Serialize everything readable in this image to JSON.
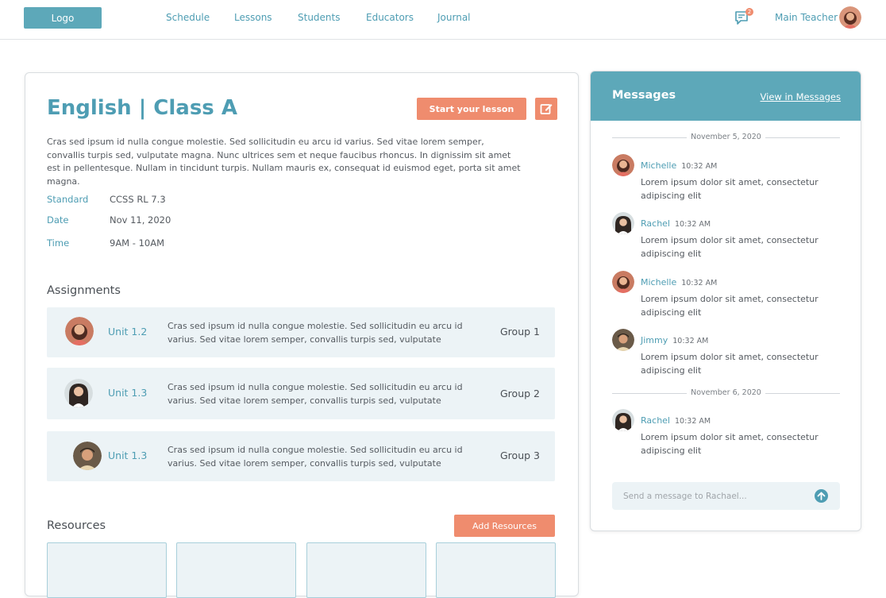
{
  "header": {
    "logo": "Logo",
    "nav": [
      "Schedule",
      "Lessons",
      "Students",
      "Educators",
      "Journal"
    ],
    "notification_count": "2",
    "user_name": "Main Teacher"
  },
  "lesson": {
    "title": "English | Class A",
    "start_button": "Start your lesson",
    "description": "Cras sed ipsum id nulla congue molestie. Sed sollicitudin eu arcu id varius. Sed vitae lorem semper, convallis turpis sed, vulputate magna. Nunc ultrices sem et neque faucibus rhoncus. In dignissim sit amet est in pellentesque. Nullam in tincidunt turpis. Nullam mauris ex, consequat id euismod eget, porta sit amet magna.",
    "meta": [
      {
        "label": "Standard",
        "value": "CCSS RL 7.3"
      },
      {
        "label": "Date",
        "value": "Nov 11, 2020"
      },
      {
        "label": "Time",
        "value": "9AM - 10AM"
      }
    ]
  },
  "assignments": {
    "heading": "Assignments",
    "items": [
      {
        "unit": "Unit 1.2",
        "text": "Cras sed ipsum id nulla congue molestie. Sed sollicitudin eu arcu id varius. Sed vitae lorem semper, convallis turpis sed, vulputate",
        "group": "Group 1"
      },
      {
        "unit": "Unit 1.3",
        "text": "Cras sed ipsum id nulla congue molestie. Sed sollicitudin eu arcu id varius. Sed vitae lorem semper, convallis turpis sed, vulputate",
        "group": "Group 2"
      },
      {
        "unit": "Unit 1.3",
        "text": "Cras sed ipsum id nulla congue molestie. Sed sollicitudin eu arcu id varius. Sed vitae lorem semper, convallis turpis sed, vulputate",
        "group": "Group 3"
      }
    ]
  },
  "resources": {
    "heading": "Resources",
    "add_button": "Add Resources"
  },
  "messages": {
    "title": "Messages",
    "view_link": "View in Messages",
    "dates": [
      "November 5, 2020",
      "November 6, 2020"
    ],
    "items": [
      {
        "name": "Michelle",
        "time": "10:32 AM",
        "text": "Lorem ipsum dolor sit amet, consectetur adipiscing elit"
      },
      {
        "name": "Rachel",
        "time": "10:32 AM",
        "text": "Lorem ipsum dolor sit amet, consectetur adipiscing elit"
      },
      {
        "name": "Michelle",
        "time": "10:32 AM",
        "text": "Lorem ipsum dolor sit amet, consectetur adipiscing elit"
      },
      {
        "name": "Jimmy",
        "time": "10:32 AM",
        "text": "Lorem ipsum dolor sit amet, consectetur adipiscing elit"
      },
      {
        "name": "Rachel",
        "time": "10:32 AM",
        "text": "Lorem ipsum dolor sit amet, consectetur adipiscing elit"
      }
    ],
    "input_placeholder": "Send a message to Rachael..."
  },
  "colors": {
    "accent": "#4e9db3",
    "header_bg": "#5da8b9",
    "button": "#ef8c6e",
    "row_bg": "#ecf3f6"
  }
}
